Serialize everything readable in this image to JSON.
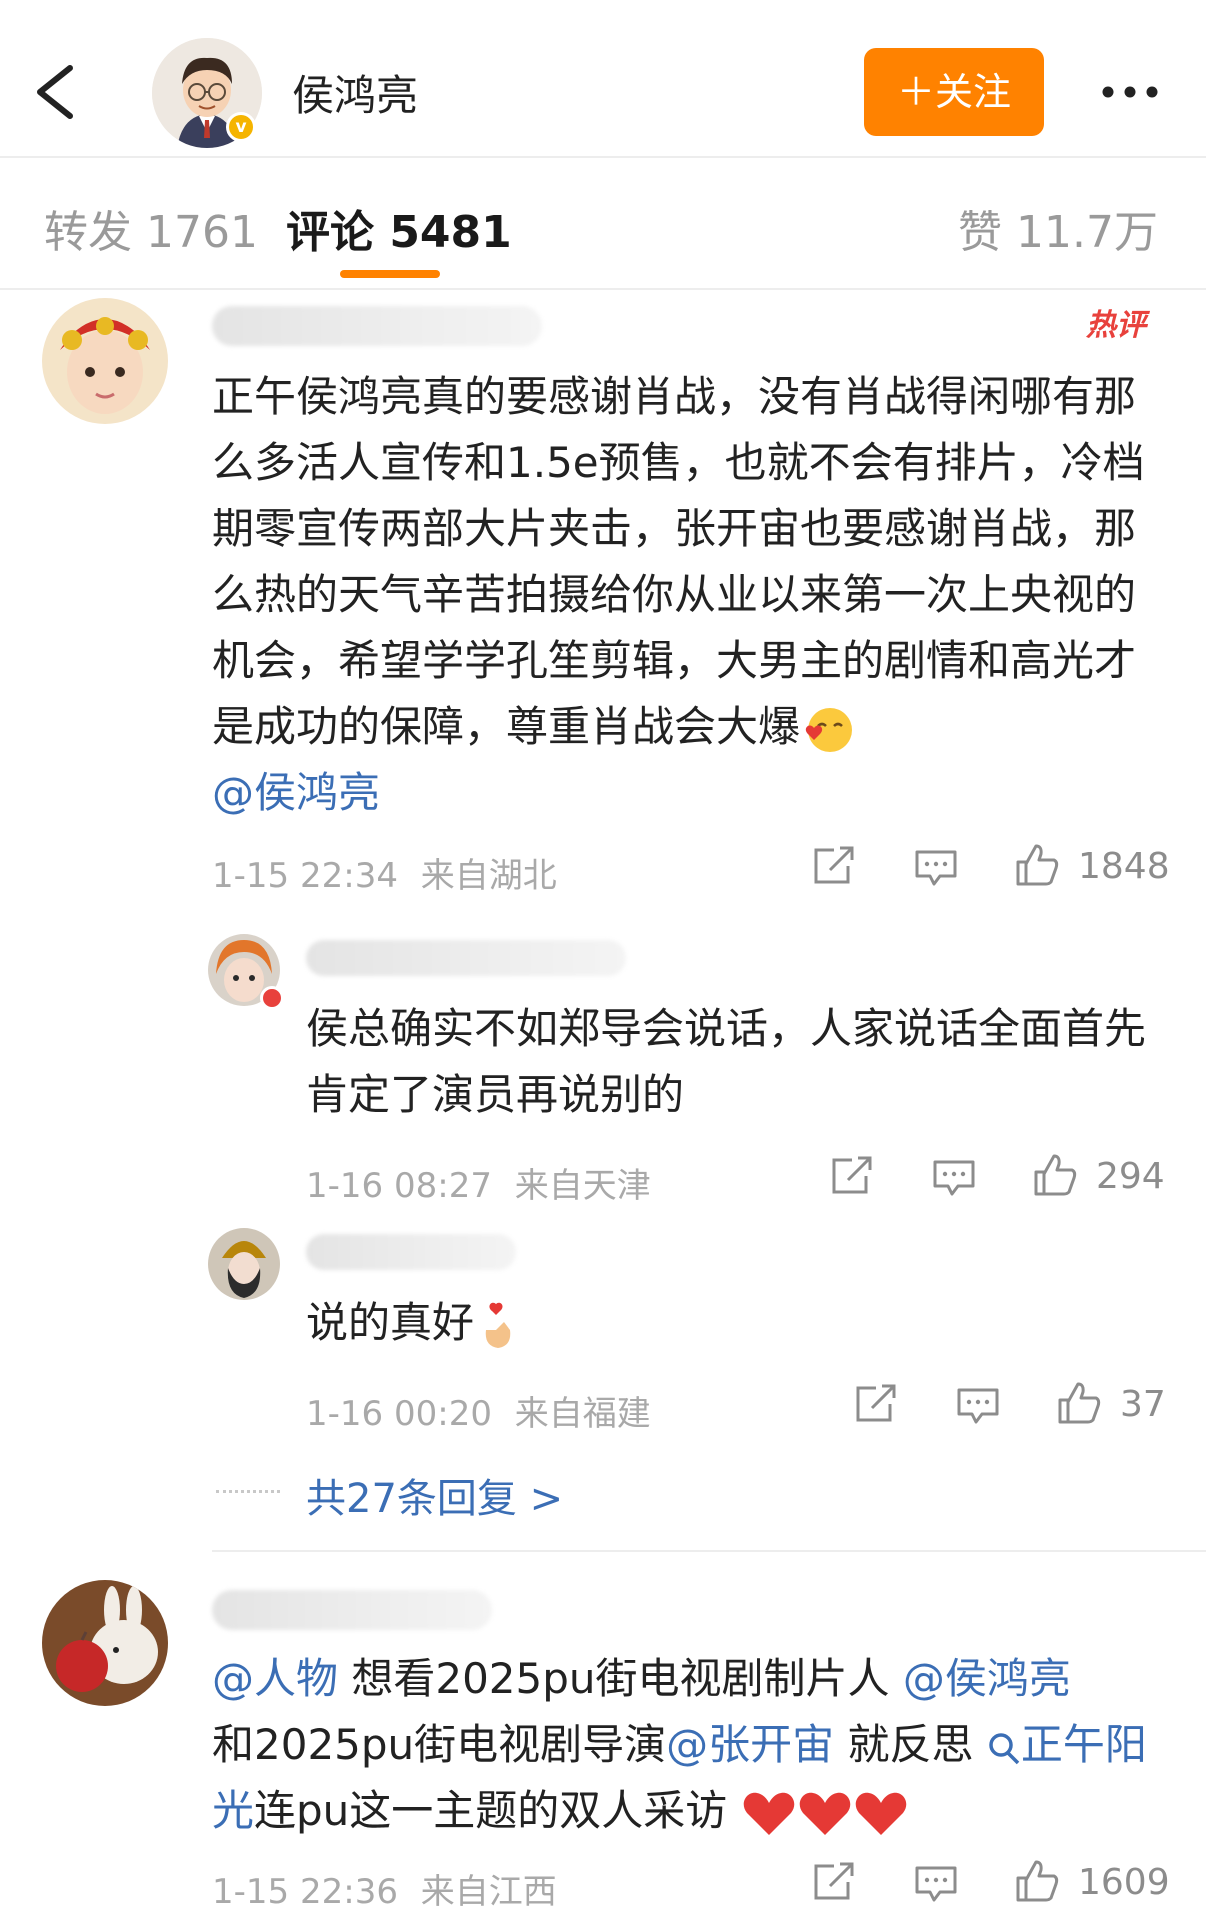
{
  "header": {
    "username": "侯鸿亮",
    "follow_label": "＋关注"
  },
  "tabs": {
    "repost": "转发 1761",
    "comments": "评论 5481",
    "likes": "赞 11.7万"
  },
  "comments": [
    {
      "badge": "热评",
      "text": "正午侯鸿亮真的要感谢肖战，没有肖战得闲哪有那么多活人宣传和1.5e预售，也就不会有排片，冷档期零宣传两部大片夹击，张开宙也要感谢肖战，那么热的天气辛苦拍摄给你从业以来第一次上央视的机会，希望学学孔笙剪辑，大男主的剧情和高光才是成功的保障，尊重肖战会大爆",
      "mention": "@侯鸿亮",
      "time": "1-15 22:34",
      "location": "来自湖北",
      "likes": "1848",
      "replies": [
        {
          "text": "侯总确实不如郑导会说话，人家说话全面首先肯定了演员再说别的",
          "time": "1-16 08:27",
          "location": "来自天津",
          "likes": "294"
        },
        {
          "text": "说的真好",
          "time": "1-16 00:20",
          "location": "来自福建",
          "likes": "37"
        }
      ],
      "more_replies": "共27条回复 >"
    },
    {
      "mention1": "@人物",
      "text1": " 想看2025pu街电视剧制片人",
      "mention2": "@侯鸿亮",
      "text2": "和2025pu街电视剧导演",
      "mention3": "@张开宙",
      "text3": " 就反思",
      "topic": "正午阳光",
      "text4": "连pu这一主题的双人采访",
      "time": "1-15 22:36",
      "location": "来自江西",
      "likes": "1609"
    }
  ],
  "colors": {
    "accent": "#ff8200",
    "link": "#3b6eb5",
    "hot": "#e8413c"
  },
  "icons": [
    "back-icon",
    "more-icon",
    "share-icon",
    "comment-icon",
    "like-icon",
    "search-icon",
    "heart-icon"
  ]
}
